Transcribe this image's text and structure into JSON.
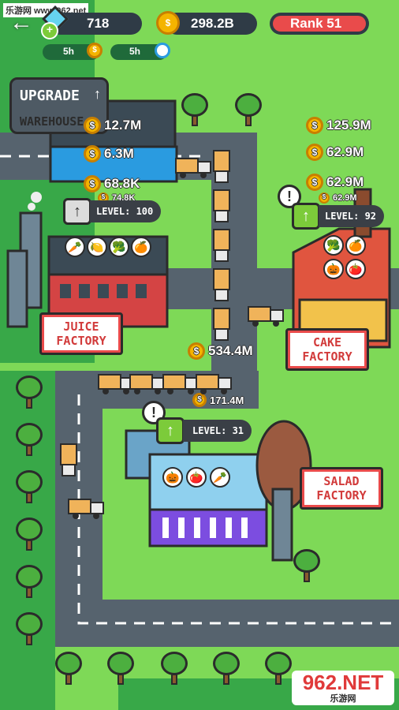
{
  "watermark": {
    "top": "乐游网 www.962.net",
    "bottom_main": "962.NET",
    "bottom_sub": "乐游网"
  },
  "hud": {
    "gems": "718",
    "coins": "298.2B",
    "rank": "Rank 51",
    "boost1_time": "5h",
    "boost2_time": "5h"
  },
  "warehouse": {
    "button_line1": "UPGRADE",
    "button_line2": "WAREHOUSE"
  },
  "warehouse_amounts": [
    "12.7M",
    "6.3M",
    "68.8K",
    "74.8K"
  ],
  "juice": {
    "level": "LEVEL: 100",
    "sign_line1": "JUICE",
    "sign_line2": "FACTORY",
    "items": [
      "🥕",
      "🍋",
      "🥦",
      "🍊"
    ]
  },
  "cake": {
    "level": "LEVEL: 92",
    "sign_line1": "CAKE",
    "sign_line2": "FACTORY",
    "amounts": [
      "125.9M",
      "62.9M",
      "62.9M",
      "62.9M"
    ],
    "items": [
      "🥦",
      "🍊",
      "🎃",
      "🍅"
    ]
  },
  "road_amounts": [
    "534.4M",
    "171.4M"
  ],
  "salad": {
    "level": "LEVEL: 31",
    "sign_line1": "SALAD",
    "sign_line2": "FACTORY",
    "items": [
      "🎃",
      "🍅",
      "🥕"
    ]
  },
  "colors": {
    "grass": "#38a848",
    "light_grass": "#7ed957",
    "road": "#56636e",
    "accent": "#7ccb3a",
    "sign_red": "#e94b4b"
  }
}
